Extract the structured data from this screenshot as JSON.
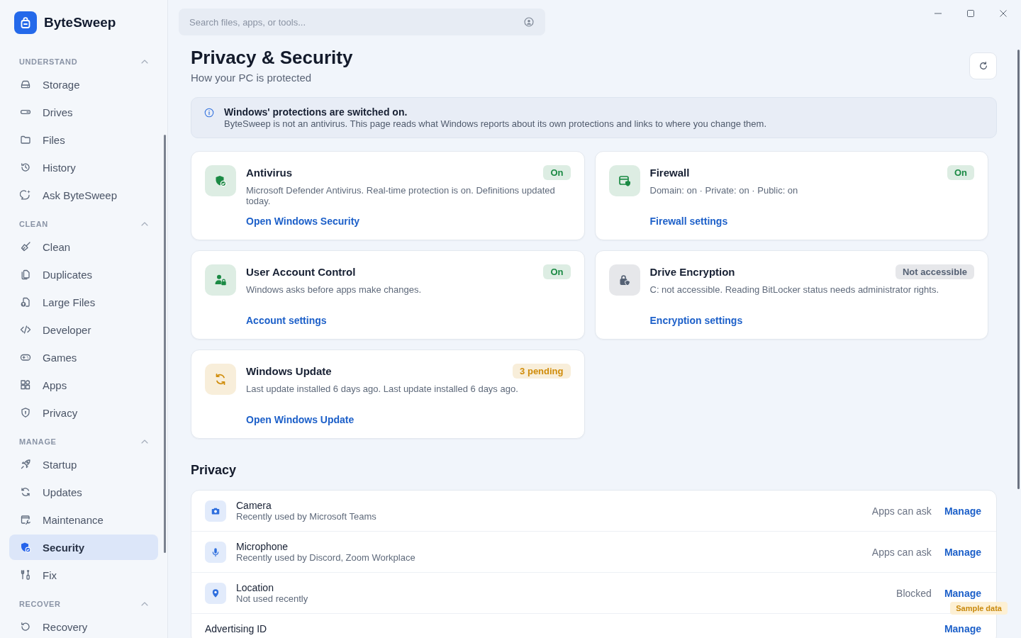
{
  "app": {
    "name": "ByteSweep"
  },
  "sidebar": {
    "sections": [
      {
        "title": "UNDERSTAND",
        "expanded": true,
        "items": [
          {
            "label": "Storage",
            "selected": false
          },
          {
            "label": "Drives",
            "selected": false
          },
          {
            "label": "Files",
            "selected": false
          },
          {
            "label": "History",
            "selected": false
          },
          {
            "label": "Ask ByteSweep",
            "selected": false
          }
        ]
      },
      {
        "title": "CLEAN",
        "expanded": true,
        "items": [
          {
            "label": "Clean",
            "selected": false
          },
          {
            "label": "Duplicates",
            "selected": false
          },
          {
            "label": "Large Files",
            "selected": false
          },
          {
            "label": "Developer",
            "selected": false
          },
          {
            "label": "Games",
            "selected": false
          },
          {
            "label": "Apps",
            "selected": false
          },
          {
            "label": "Privacy",
            "selected": false
          }
        ]
      },
      {
        "title": "MANAGE",
        "expanded": true,
        "items": [
          {
            "label": "Startup",
            "selected": false
          },
          {
            "label": "Updates",
            "selected": false
          },
          {
            "label": "Maintenance",
            "selected": false
          },
          {
            "label": "Security",
            "selected": true
          },
          {
            "label": "Fix",
            "selected": false
          }
        ]
      },
      {
        "title": "RECOVER",
        "expanded": true,
        "items": [
          {
            "label": "Recovery",
            "selected": false
          }
        ]
      }
    ]
  },
  "search": {
    "placeholder": "Search files, apps, or tools..."
  },
  "header": {
    "title": "Privacy & Security",
    "subtitle": "How your PC is protected"
  },
  "notice": {
    "title": "Windows' protections are switched on.",
    "text": "ByteSweep is not an antivirus. This page reads what Windows reports about its own protections and links to where you change them."
  },
  "protections": [
    {
      "title": "Antivirus",
      "description": "Microsoft Defender Antivirus. Real-time protection is on. Definitions updated today.",
      "status": "On",
      "color": "#1b8a44",
      "link": "Open Windows Security"
    },
    {
      "title": "Firewall",
      "description": "Domain: on · Private: on · Public: on",
      "status": "On",
      "color": "#1b8a44",
      "link": "Firewall settings"
    },
    {
      "title": "User Account Control",
      "description": "Windows asks before apps make changes.",
      "status": "On",
      "color": "#1b8a44",
      "link": "Account settings"
    },
    {
      "title": "Drive Encryption",
      "description": "C: not accessible. Reading BitLocker status needs administrator rights.",
      "status": "Not accessible",
      "color": "#556174",
      "link": "Encryption settings"
    },
    {
      "title": "Windows Update",
      "description": "Last update installed 6 days ago. Last update installed 6 days ago.",
      "status": "3 pending",
      "color": "#d08c0a",
      "link": "Open Windows Update"
    }
  ],
  "privacy": {
    "title": "Privacy",
    "rows": [
      {
        "title": "Camera",
        "detail": "Recently used by Microsoft Teams",
        "status": "Apps can ask",
        "action": "Manage"
      },
      {
        "title": "Microphone",
        "detail": "Recently used by Discord, Zoom Workplace",
        "status": "Apps can ask",
        "action": "Manage"
      },
      {
        "title": "Location",
        "detail": "Not used recently",
        "status": "Blocked",
        "action": "Manage"
      },
      {
        "title": "Advertising ID",
        "action": "Manage"
      }
    ]
  },
  "sample_badge": "Sample data"
}
